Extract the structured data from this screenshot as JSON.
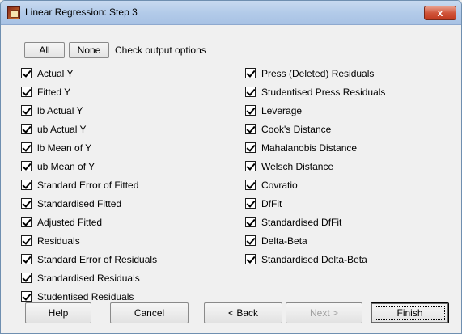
{
  "window": {
    "title": "Linear Regression: Step 3",
    "close_label": "x"
  },
  "top_controls": {
    "all_label": "All",
    "none_label": "None",
    "caption": "Check output options"
  },
  "left_options": [
    {
      "label": "Actual Y",
      "checked": true
    },
    {
      "label": "Fitted Y",
      "checked": true
    },
    {
      "label": "lb Actual Y",
      "checked": true
    },
    {
      "label": "ub Actual Y",
      "checked": true
    },
    {
      "label": "lb Mean of Y",
      "checked": true
    },
    {
      "label": "ub Mean of Y",
      "checked": true
    },
    {
      "label": "Standard Error of Fitted",
      "checked": true
    },
    {
      "label": "Standardised Fitted",
      "checked": true
    },
    {
      "label": "Adjusted Fitted",
      "checked": true
    },
    {
      "label": "Residuals",
      "checked": true
    },
    {
      "label": "Standard Error of Residuals",
      "checked": true
    },
    {
      "label": "Standardised Residuals",
      "checked": true
    },
    {
      "label": "Studentised Residuals",
      "checked": true
    }
  ],
  "right_options": [
    {
      "label": "Press (Deleted) Residuals",
      "checked": true
    },
    {
      "label": "Studentised Press Residuals",
      "checked": true
    },
    {
      "label": "Leverage",
      "checked": true
    },
    {
      "label": "Cook's Distance",
      "checked": true
    },
    {
      "label": "Mahalanobis Distance",
      "checked": true
    },
    {
      "label": "Welsch Distance",
      "checked": true
    },
    {
      "label": "Covratio",
      "checked": true
    },
    {
      "label": "DfFit",
      "checked": true
    },
    {
      "label": "Standardised DfFit",
      "checked": true
    },
    {
      "label": "Delta-Beta",
      "checked": true
    },
    {
      "label": "Standardised Delta-Beta",
      "checked": true
    }
  ],
  "footer": {
    "help_label": "Help",
    "cancel_label": "Cancel",
    "back_label": "< Back",
    "next_label": "Next >",
    "finish_label": "Finish"
  }
}
